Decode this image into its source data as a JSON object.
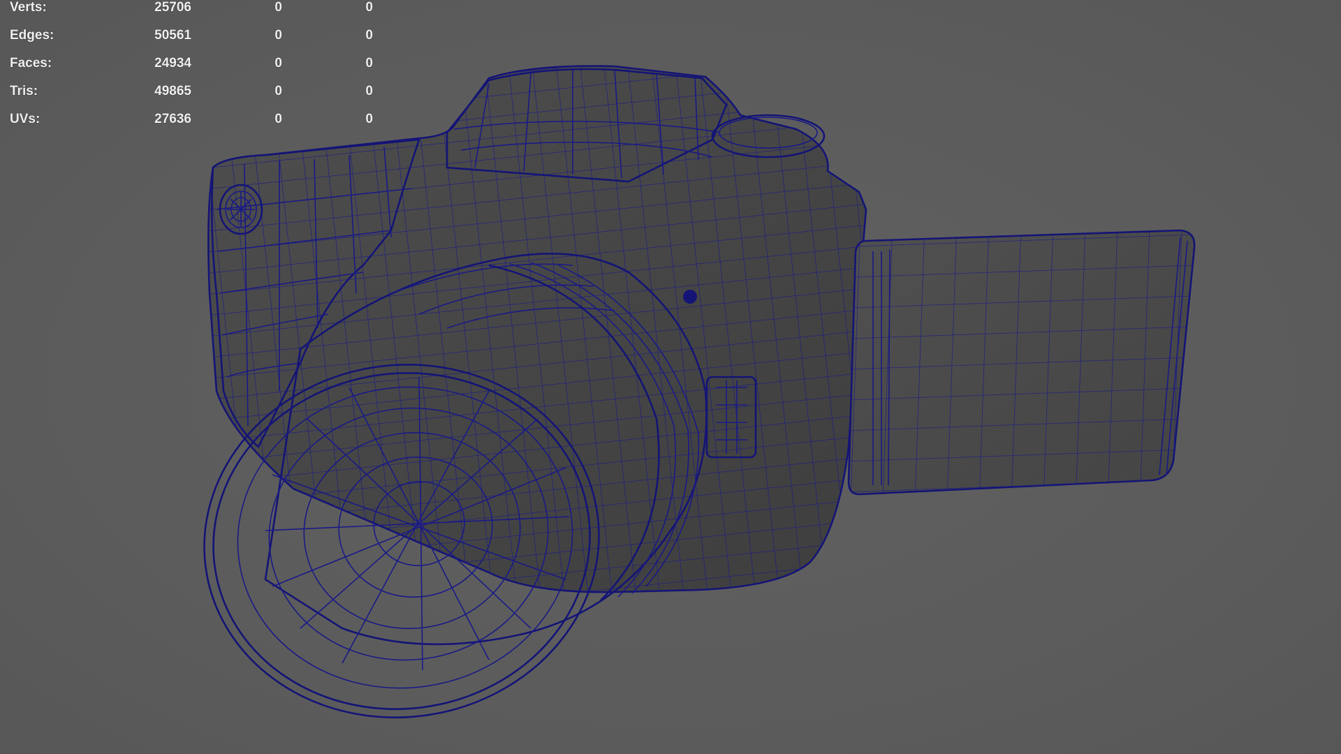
{
  "hud": {
    "rows": [
      {
        "label": "Verts:",
        "v1": "25706",
        "v2": "0",
        "v3": "0"
      },
      {
        "label": "Edges:",
        "v1": "50561",
        "v2": "0",
        "v3": "0"
      },
      {
        "label": "Faces:",
        "v1": "24934",
        "v2": "0",
        "v3": "0"
      },
      {
        "label": "Tris:",
        "v1": "49865",
        "v2": "0",
        "v3": "0"
      },
      {
        "label": "UVs:",
        "v1": "27636",
        "v2": "0",
        "v3": "0"
      }
    ]
  },
  "colors": {
    "viewport_bg": "#5d5d5d",
    "mesh_fill": "#474747",
    "wireframe": "#1a1a86",
    "hud_text": "#f0f0f0"
  },
  "icons": {
    "model": "camera-wireframe-model"
  }
}
